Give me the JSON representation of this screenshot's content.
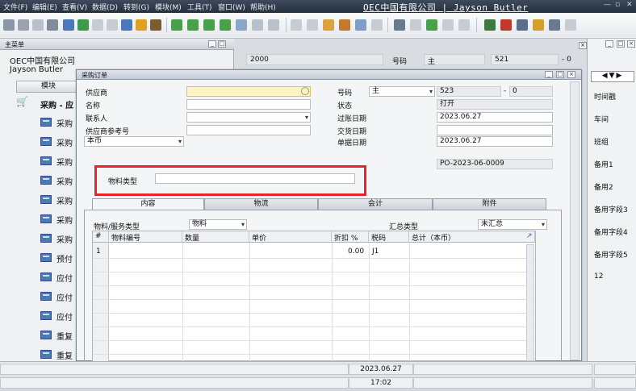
{
  "menu": {
    "items": [
      "文件(F)",
      "编辑(E)",
      "查看(V)",
      "数据(D)",
      "转到(G)",
      "模块(M)",
      "工具(T)",
      "窗口(W)",
      "帮助(H)"
    ],
    "company_user": "OEC中国有限公司 | Jayson Butler"
  },
  "main_menu": {
    "title": "主菜单",
    "company": "OEC中国有限公司",
    "user": "Jayson Butler",
    "tab": "模块",
    "section": "采购 - 应",
    "items": [
      "采购",
      "采购",
      "采购",
      "采购",
      "采购",
      "采购",
      "采购",
      "预付",
      "应付",
      "应付",
      "应付",
      "重复",
      "重复"
    ]
  },
  "bg_form": {
    "year_value": "2000",
    "number_label": "号码",
    "series": "主",
    "number": "521",
    "suffix": "- 0"
  },
  "right_panel": {
    "fields": [
      "时间戳",
      "车间",
      "班组",
      "备用1",
      "备用2",
      "备用字段3",
      "备用字段4",
      "备用字段5",
      "12"
    ]
  },
  "order": {
    "title": "采购订单",
    "vendor_label": "供应商",
    "name_label": "名称",
    "contact_label": "联系人",
    "vendor_ref_label": "供应商参考号",
    "currency": "本币",
    "number_label": "号码",
    "series": "主",
    "number": "523",
    "number_suffix": "0",
    "status_label": "状态",
    "status_value": "打开",
    "posting_label": "过账日期",
    "posting_value": "2023.06.27",
    "delivery_label": "交货日期",
    "delivery_value": "",
    "doc_date_label": "单据日期",
    "doc_date_value": "2023.06.27",
    "doc_code": "PO-2023-06-0009",
    "material_type_label": "物料类型",
    "material_type_value": "",
    "tabs": [
      "内容",
      "物流",
      "会计",
      "附件"
    ],
    "item_type_label": "物料/服务类型",
    "item_type_value": "物料",
    "summary_label": "汇总类型",
    "summary_value": "未汇总",
    "columns": [
      "#",
      "物料编号",
      "数量",
      "单价",
      "折扣 %",
      "税码",
      "总计（本币）"
    ],
    "row1": {
      "num": "1",
      "discount": "0.00",
      "tax": "J1"
    }
  },
  "status": {
    "date": "2023.06.27",
    "time": "17:02"
  },
  "colors": {
    "highlight": "#e8232a",
    "mandatory_field": "#fdf3c4",
    "menubar": "#26303d"
  }
}
